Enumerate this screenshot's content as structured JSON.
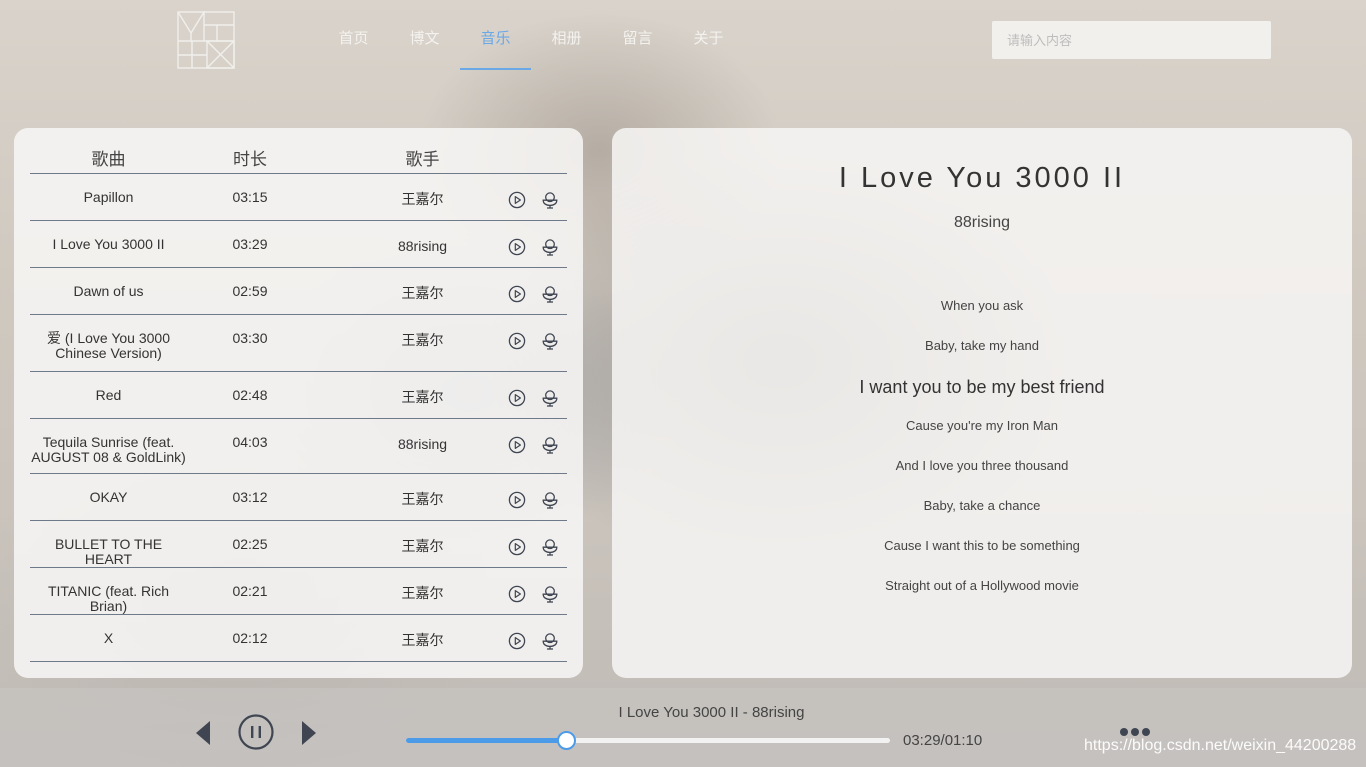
{
  "nav": {
    "items": [
      {
        "label": "首页",
        "active": false
      },
      {
        "label": "博文",
        "active": false
      },
      {
        "label": "音乐",
        "active": true
      },
      {
        "label": "相册",
        "active": false
      },
      {
        "label": "留言",
        "active": false
      },
      {
        "label": "关于",
        "active": false
      }
    ],
    "search_placeholder": "请输入内容"
  },
  "song_list": {
    "headers": {
      "song": "歌曲",
      "duration": "时长",
      "artist": "歌手"
    },
    "rows": [
      {
        "song": "Papillon",
        "duration": "03:15",
        "artist": "王嘉尔"
      },
      {
        "song": "I Love You 3000 II",
        "duration": "03:29",
        "artist": "88rising"
      },
      {
        "song": "Dawn of us",
        "duration": "02:59",
        "artist": "王嘉尔"
      },
      {
        "song": "爱 (I Love You 3000 Chinese Version)",
        "duration": "03:30",
        "artist": "王嘉尔"
      },
      {
        "song": "Red",
        "duration": "02:48",
        "artist": "王嘉尔"
      },
      {
        "song": "Tequila Sunrise (feat. AUGUST 08 & GoldLink)",
        "duration": "04:03",
        "artist": "88rising"
      },
      {
        "song": "OKAY",
        "duration": "03:12",
        "artist": "王嘉尔"
      },
      {
        "song": "BULLET TO THE HEART",
        "duration": "02:25",
        "artist": "王嘉尔"
      },
      {
        "song": "TITANIC (feat. Rich Brian)",
        "duration": "02:21",
        "artist": "王嘉尔"
      },
      {
        "song": "X",
        "duration": "02:12",
        "artist": "王嘉尔"
      }
    ]
  },
  "lyrics": {
    "title": "I Love You 3000 II",
    "artist": "88rising",
    "lines": [
      {
        "text": "When you ask",
        "current": false
      },
      {
        "text": "Baby, take my hand",
        "current": false
      },
      {
        "text": "I want you to be my best friend",
        "current": true
      },
      {
        "text": "Cause you're my Iron Man",
        "current": false
      },
      {
        "text": "And I love you three thousand",
        "current": false
      },
      {
        "text": "Baby, take a chance",
        "current": false
      },
      {
        "text": "Cause I want this to be something",
        "current": false
      },
      {
        "text": "Straight out of a Hollywood movie",
        "current": false
      }
    ]
  },
  "player": {
    "now_playing": "I Love You 3000 II - 88rising",
    "time": "03:29/01:10",
    "progress_percent": 33,
    "accent_color": "#4c9be8"
  },
  "watermark": "https://blog.csdn.net/weixin_44200288"
}
